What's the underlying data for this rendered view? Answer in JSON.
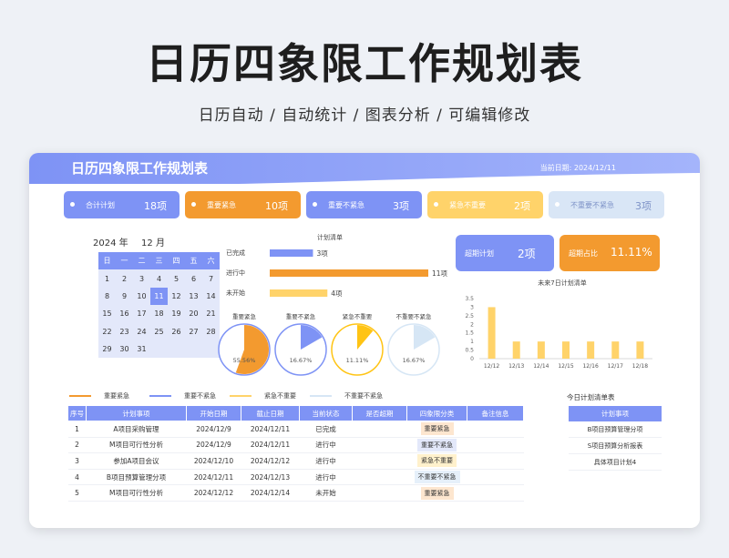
{
  "header": {
    "title": "日历四象限工作规划表",
    "subtitle": "日历自动 / 自动统计 / 图表分析 / 可编辑修改"
  },
  "sheet": {
    "title": "日历四象限工作规划表",
    "date_label": "当前日期: 2024/12/11"
  },
  "stats": [
    {
      "label": "合计计划",
      "count": "18项",
      "color": "#7e93f5"
    },
    {
      "label": "重要紧急",
      "count": "10项",
      "color": "#f39a2f"
    },
    {
      "label": "重要不紧急",
      "count": "3项",
      "color": "#7e93f5"
    },
    {
      "label": "紧急不重要",
      "count": "2项",
      "color": "#ffd36a"
    },
    {
      "label": "不重要不紧急",
      "count": "3项",
      "color": "#d9e6f6"
    }
  ],
  "calendar": {
    "year": "2024",
    "year_unit": "年",
    "month": "12",
    "month_unit": "月",
    "weekdays": [
      "日",
      "一",
      "二",
      "三",
      "四",
      "五",
      "六"
    ],
    "rows": [
      [
        "1",
        "2",
        "3",
        "4",
        "5",
        "6",
        "7"
      ],
      [
        "8",
        "9",
        "10",
        "11",
        "12",
        "13",
        "14"
      ],
      [
        "15",
        "16",
        "17",
        "18",
        "19",
        "20",
        "21"
      ],
      [
        "22",
        "23",
        "24",
        "25",
        "26",
        "27",
        "28"
      ],
      [
        "29",
        "30",
        "31",
        "",
        "",
        "",
        ""
      ]
    ],
    "today": "11"
  },
  "status_chart": {
    "title": "计划清单",
    "rows": [
      {
        "label": "已完成",
        "value": 3,
        "text": "3项",
        "color": "#7e93f5"
      },
      {
        "label": "进行中",
        "value": 11,
        "text": "11项",
        "color": "#f39a2f"
      },
      {
        "label": "未开始",
        "value": 4,
        "text": "4项",
        "color": "#ffd36a"
      }
    ]
  },
  "pies": [
    {
      "label": "重要紧急",
      "pct": 55.56,
      "text": "55.56%",
      "color": "#f39a2f",
      "border": "#7e93f5"
    },
    {
      "label": "重要不紧急",
      "pct": 16.67,
      "text": "16.67%",
      "color": "#7e93f5",
      "border": "#7e93f5"
    },
    {
      "label": "紧急不重要",
      "pct": 11.11,
      "text": "11.11%",
      "color": "#ffc414",
      "border": "#ffc414"
    },
    {
      "label": "不重要不紧急",
      "pct": 16.67,
      "text": "16.67%",
      "color": "#d6e6f5",
      "border": "#d6e6f5"
    }
  ],
  "overdue": {
    "count_label": "超期计划",
    "count_value": "2项",
    "ratio_label": "超期占比",
    "ratio_value": "11.11%"
  },
  "chart_data": {
    "type": "bar",
    "title": "未来7日计划清单",
    "categories": [
      "12/12",
      "12/13",
      "12/14",
      "12/15",
      "12/16",
      "12/17",
      "12/18"
    ],
    "values": [
      3,
      1,
      1,
      1,
      1,
      1,
      1
    ],
    "ylim": [
      0,
      3.5
    ],
    "yticks": [
      "3.5",
      "3",
      "2.5",
      "2",
      "1.5",
      "1",
      "0.5",
      "0"
    ],
    "color": "#ffd36a"
  },
  "legend": [
    {
      "label": "重要紧急",
      "color": "#f39a2f"
    },
    {
      "label": "重要不紧急",
      "color": "#7e93f5"
    },
    {
      "label": "紧急不重要",
      "color": "#ffd36a"
    },
    {
      "label": "不重要不紧急",
      "color": "#d6e6f5"
    }
  ],
  "plan_table": {
    "headers": [
      "序号",
      "计划事项",
      "开始日期",
      "截止日期",
      "当前状态",
      "是否超期",
      "四象限分类",
      "备注信息"
    ],
    "rows": [
      {
        "no": "1",
        "item": "A项目采购管理",
        "start": "2024/12/9",
        "end": "2024/12/11",
        "status": "已完成",
        "overdue": "",
        "cat": "重要紧急",
        "note": "",
        "cat_bg": "#fde6cf"
      },
      {
        "no": "2",
        "item": "M项目可行性分析",
        "start": "2024/12/9",
        "end": "2024/12/11",
        "status": "进行中",
        "overdue": "",
        "cat": "重要不紧急",
        "note": "",
        "cat_bg": "#e3e8fa"
      },
      {
        "no": "3",
        "item": "参加A项目会议",
        "start": "2024/12/10",
        "end": "2024/12/12",
        "status": "进行中",
        "overdue": "",
        "cat": "紧急不重要",
        "note": "",
        "cat_bg": "#fff1cc"
      },
      {
        "no": "4",
        "item": "B项目预算管理分项",
        "start": "2024/12/11",
        "end": "2024/12/13",
        "status": "进行中",
        "overdue": "",
        "cat": "不重要不紧急",
        "note": "",
        "cat_bg": "#e6f0fa"
      },
      {
        "no": "5",
        "item": "M项目可行性分析",
        "start": "2024/12/12",
        "end": "2024/12/14",
        "status": "未开始",
        "overdue": "",
        "cat": "重要紧急",
        "note": "",
        "cat_bg": "#fde6cf"
      }
    ]
  },
  "today_list": {
    "title": "今日计划清单表",
    "header": "计划事项",
    "items": [
      "B项目预算管理分项",
      "S项目预算分析报表",
      "具体项目计划4"
    ]
  }
}
